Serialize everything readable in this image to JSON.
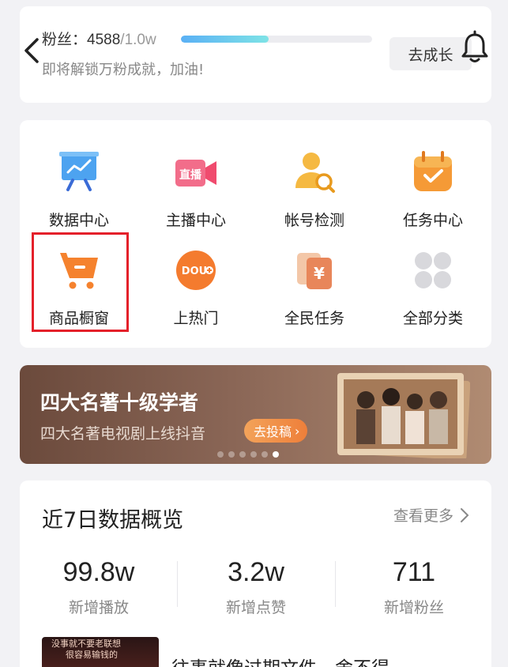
{
  "fans": {
    "label": "粉丝：",
    "count": "4588",
    "total": "/1.0w",
    "progress": 0.46,
    "subtitle": "即将解锁万粉成就，加油!",
    "grow_button": "去成长"
  },
  "menu": {
    "items": [
      {
        "label": "数据中心",
        "icon": "chart-screen-icon"
      },
      {
        "label": "主播中心",
        "icon": "live-camera-icon"
      },
      {
        "label": "帐号检测",
        "icon": "user-search-icon"
      },
      {
        "label": "任务中心",
        "icon": "calendar-check-icon"
      },
      {
        "label": "商品橱窗",
        "icon": "shopping-cart-icon"
      },
      {
        "label": "上热门",
        "icon": "dou-plus-icon"
      },
      {
        "label": "全民任务",
        "icon": "yuan-cards-icon"
      },
      {
        "label": "全部分类",
        "icon": "grid-dots-icon"
      }
    ]
  },
  "banner": {
    "title": "四大名著十级学者",
    "subtitle": "四大名著电视剧上线抖音",
    "button": "去投稿",
    "dots": 6,
    "active_dot": 5
  },
  "stats": {
    "title": "近7日数据概览",
    "more": "查看更多",
    "items": [
      {
        "value": "99.8w",
        "label": "新增播放"
      },
      {
        "value": "3.2w",
        "label": "新增点赞"
      },
      {
        "value": "711",
        "label": "新增粉丝"
      }
    ],
    "video": {
      "thumb_text_1": "没事就不要老联想",
      "thumb_text_2": "很容易输钱的",
      "title": "往事就像过期文件，舍不得..."
    }
  },
  "colors": {
    "accent_orange": "#f08a3c",
    "highlight_red": "#e4202a",
    "progress_blue": "#5ab0f5"
  }
}
